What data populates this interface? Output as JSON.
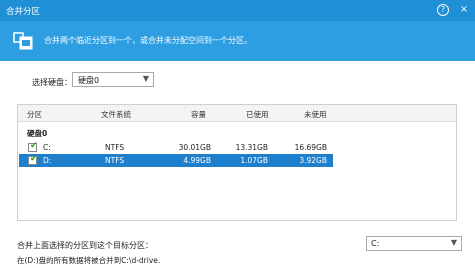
{
  "window": {
    "title": "合并分区",
    "help_icon": "?",
    "close_icon": "×"
  },
  "banner": {
    "icon": "merge-partitions-icon",
    "text": "合并两个临近分区到一个，或合并未分配空间到一个分区。"
  },
  "disk_select": {
    "label": "选择硬盘：",
    "value": "硬盘0"
  },
  "table": {
    "columns": [
      "分区",
      "文件系统",
      "容量",
      "已使用",
      "未使用"
    ],
    "disk_name": "硬盘0",
    "rows": [
      {
        "name": "C:",
        "fs": "NTFS",
        "capacity": "30.01GB",
        "used": "13.31GB",
        "free": "16.69GB",
        "checked": true,
        "selected": false
      },
      {
        "name": "D:",
        "fs": "NTFS",
        "capacity": "4.99GB",
        "used": "1.07GB",
        "free": "3.92GB",
        "checked": true,
        "selected": true
      }
    ]
  },
  "merge_target": {
    "label": "合并上面选择的分区到这个目标分区：",
    "value": "C:",
    "note": "在(D:)盘的所有数据将被合并到C:\\d-drive."
  },
  "colors": {
    "titlebar": "#1f8fd6",
    "banner": "#2e9ee3",
    "selected_row": "#1e7fcd",
    "check": "#22a020"
  }
}
